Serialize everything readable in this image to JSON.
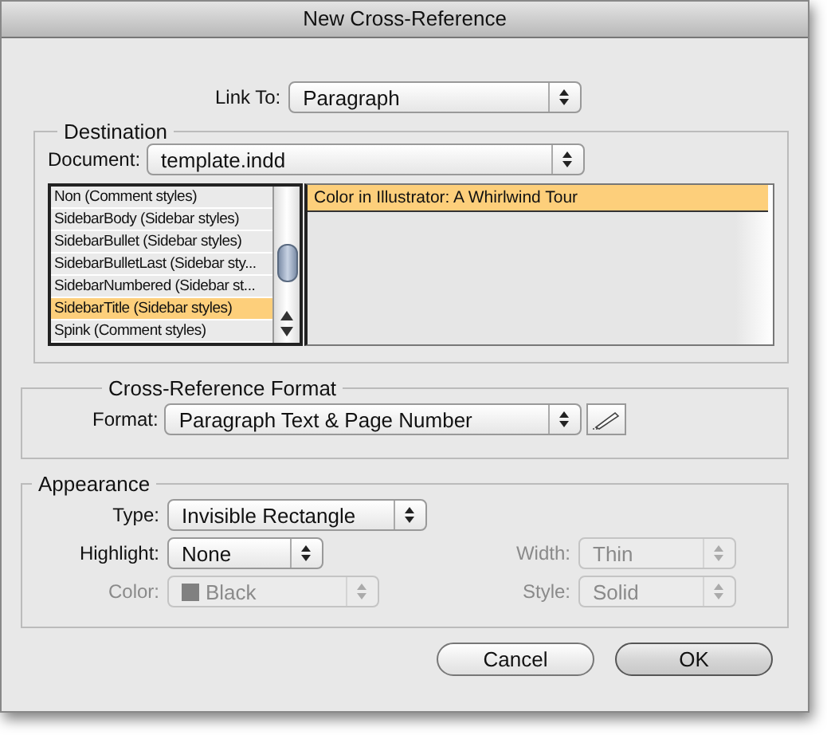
{
  "window": {
    "title": "New Cross-Reference"
  },
  "link_to": {
    "label": "Link To:",
    "value": "Paragraph"
  },
  "destination": {
    "title": "Destination",
    "document": {
      "label": "Document:",
      "value": "template.indd"
    },
    "styles": [
      {
        "text": "Non (Comment styles)",
        "selected": false
      },
      {
        "text": "SidebarBody (Sidebar styles)",
        "selected": false
      },
      {
        "text": "SidebarBullet (Sidebar styles)",
        "selected": false
      },
      {
        "text": "SidebarBulletLast (Sidebar sty...",
        "selected": false
      },
      {
        "text": "SidebarNumbered (Sidebar st...",
        "selected": false
      },
      {
        "text": "SidebarTitle (Sidebar styles)",
        "selected": true
      },
      {
        "text": "Spink (Comment styles)",
        "selected": false
      }
    ],
    "paragraphs": [
      {
        "text": "Color in Illustrator: A Whirlwind Tour",
        "selected": true
      }
    ]
  },
  "format_section": {
    "title": "Cross-Reference Format",
    "format": {
      "label": "Format:",
      "value": "Paragraph Text & Page Number"
    }
  },
  "appearance": {
    "title": "Appearance",
    "left": [
      {
        "label": "Type:",
        "value": "Invisible Rectangle",
        "disabled": false
      },
      {
        "label": "Highlight:",
        "value": "None",
        "disabled": false
      },
      {
        "label": "Color:",
        "value": "Black",
        "disabled": true,
        "color": "#808080"
      }
    ],
    "right": [
      {
        "label": "Width:",
        "value": "Thin",
        "disabled": true
      },
      {
        "label": "Style:",
        "value": "Solid",
        "disabled": true
      }
    ]
  },
  "buttons": [
    {
      "label": "Cancel",
      "default": false
    },
    {
      "label": "OK",
      "default": true
    }
  ]
}
